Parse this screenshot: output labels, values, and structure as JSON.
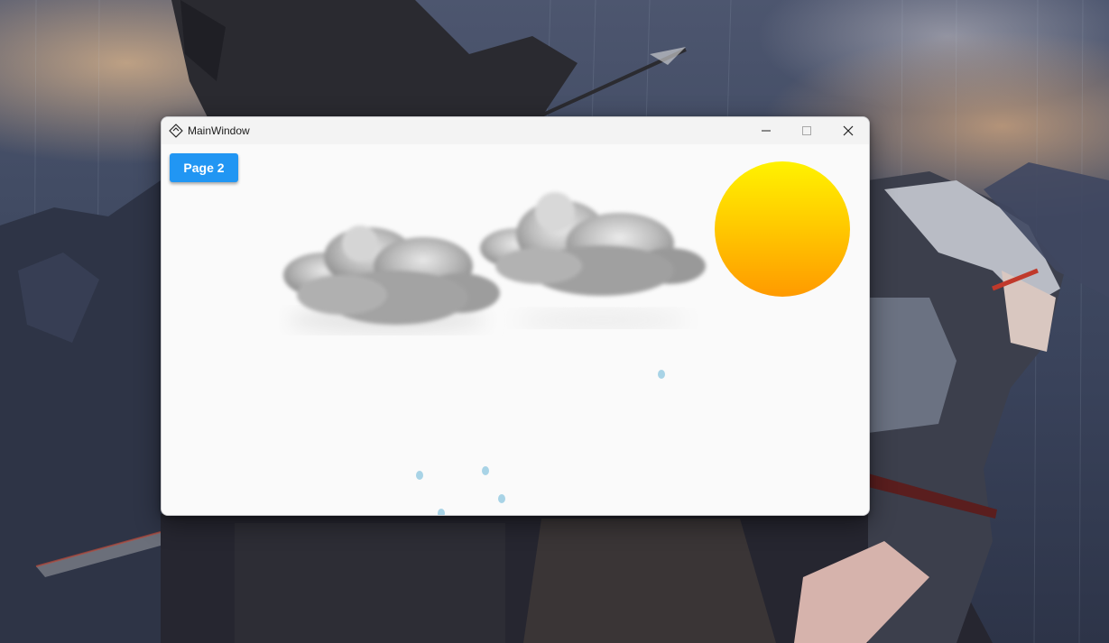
{
  "window": {
    "title": "MainWindow",
    "title_icon": "app-icon",
    "controls": {
      "minimize_icon": "minimize-icon",
      "maximize_icon": "maximize-icon",
      "close_icon": "close-icon"
    }
  },
  "content": {
    "page_button_label": "Page 2",
    "scene": {
      "sun_colors": [
        "#fff200",
        "#ff9a00"
      ],
      "cloud_color": "#9e9e9e",
      "raindrop_color": "#a8d3e6",
      "raindrop_count": 5,
      "cloud_count": 2
    }
  },
  "theme": {
    "accent": "#2196f3",
    "window_background": "#fafafa",
    "titlebar_background": "#f3f3f3"
  }
}
